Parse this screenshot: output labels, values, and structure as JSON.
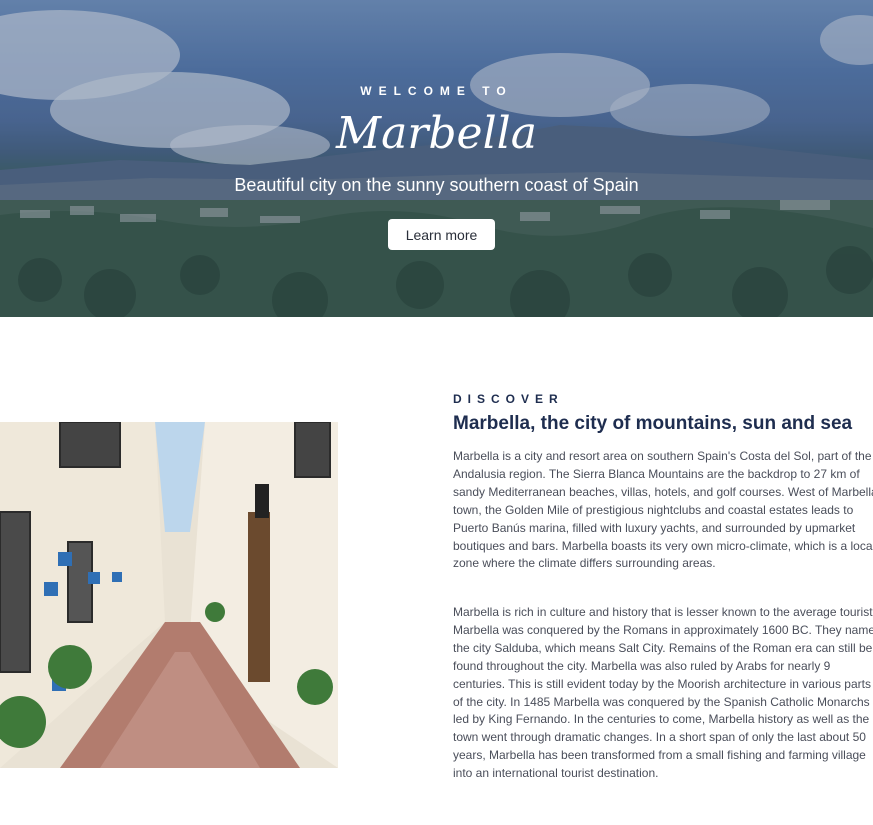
{
  "hero": {
    "eyebrow": "WELCOME TO",
    "title": "Marbella",
    "subtitle": "Beautiful city on the sunny southern coast of Spain",
    "button_label": "Learn more"
  },
  "discover": {
    "eyebrow": "DISCOVER",
    "title": "Marbella, the city of mountains, sun and sea",
    "paragraphs": [
      "Marbella is a city and resort area on southern Spain's Costa del Sol, part of the Andalusia region. The Sierra Blanca Mountains are the backdrop to 27 km of sandy Mediterranean beaches, villas, hotels, and golf courses. West of Marbella town, the Golden Mile of prestigious nightclubs and coastal estates leads to Puerto Banús marina, filled with luxury yachts, and surrounded by upmarket boutiques and bars. Marbella boasts its very own micro-climate, which is a local zone where the climate differs surrounding areas.",
      "Marbella is rich in culture and history that is lesser known to the average tourist. Marbella was conquered by the Romans in approximately 1600 BC. They named the city Salduba, which means Salt City. Remains of the Roman era can still be found throughout the city. Marbella was also ruled by Arabs for nearly 9 centuries. This is still evident today by the Moorish architecture in various parts of the city. In 1485 Marbella was conquered by the Spanish Catholic Monarchs led by King Fernando. In the centuries to come, Marbella history as well as the town went through dramatic changes. In a short span of only the last about 50 years, Marbella has been transformed from a small fishing and farming village into an international tourist destination."
    ]
  },
  "colors": {
    "heading": "#1e2d4f",
    "body_text": "#4a4e5a",
    "hero_text": "#ffffff"
  }
}
